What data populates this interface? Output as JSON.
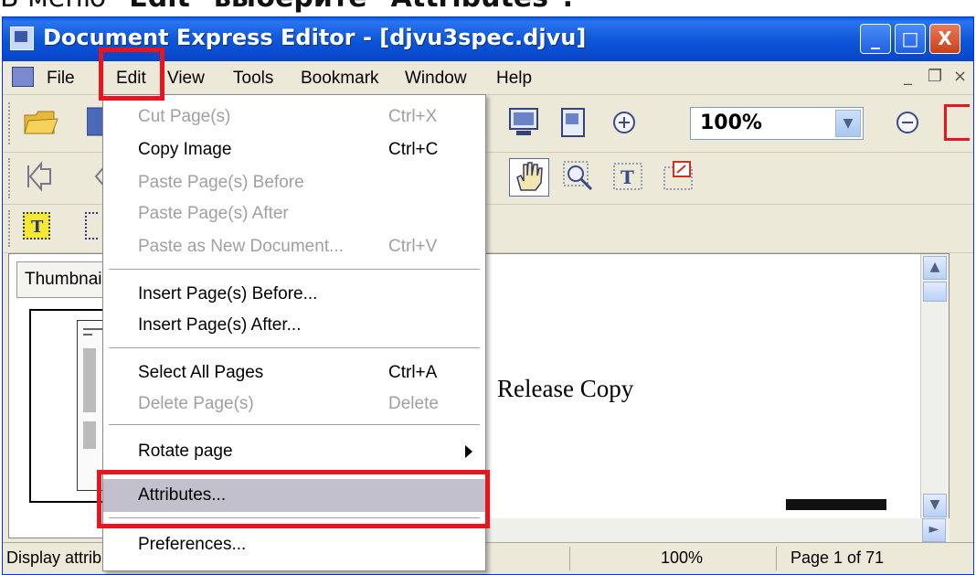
{
  "caption": {
    "prefix": "В меню ",
    "q1": "\"",
    "menu": "Edit",
    "mid": "\" выберите \"",
    "item": "Attributes",
    "q2": "\"."
  },
  "window": {
    "title": "Document Express Editor - [djvu3spec.djvu]",
    "min": "_",
    "max": "□",
    "close": "X"
  },
  "menubar": {
    "items": [
      "File",
      "Edit",
      "View",
      "Tools",
      "Bookmark",
      "Window",
      "Help"
    ],
    "mdi_min": "_",
    "mdi_restore": "❐",
    "mdi_close": "×"
  },
  "toolbar": {
    "zoom_value": "100%"
  },
  "panel": {
    "tab_label": "Thumbnails"
  },
  "document": {
    "text": "Release Copy"
  },
  "edit_menu": {
    "items": [
      {
        "label": "Cut Page(s)",
        "shortcut": "Ctrl+X",
        "disabled": true
      },
      {
        "label": "Copy Image",
        "shortcut": "Ctrl+C",
        "disabled": false
      },
      {
        "label": "Paste Page(s) Before",
        "shortcut": "",
        "disabled": true
      },
      {
        "label": "Paste Page(s) After",
        "shortcut": "",
        "disabled": true
      },
      {
        "label": "Paste as New Document...",
        "shortcut": "Ctrl+V",
        "disabled": true
      },
      {
        "label": "Insert Page(s) Before...",
        "shortcut": "",
        "disabled": false
      },
      {
        "label": "Insert Page(s) After...",
        "shortcut": "",
        "disabled": false
      },
      {
        "label": "Select All Pages",
        "shortcut": "Ctrl+A",
        "disabled": false
      },
      {
        "label": "Delete Page(s)",
        "shortcut": "Delete",
        "disabled": true
      },
      {
        "label": "Rotate page",
        "shortcut": "",
        "disabled": false
      },
      {
        "label": "Attributes...",
        "shortcut": "",
        "disabled": false
      },
      {
        "label": "Preferences...",
        "shortcut": "",
        "disabled": false
      }
    ]
  },
  "statusbar": {
    "message": "Display attributes dialog",
    "zoom": "100%",
    "page": "Page 1 of 71"
  },
  "colors": {
    "highlight_red": "#e8151f",
    "titlebar_blue": "#0b55d8",
    "menu_hover": "#c1c0cc"
  }
}
